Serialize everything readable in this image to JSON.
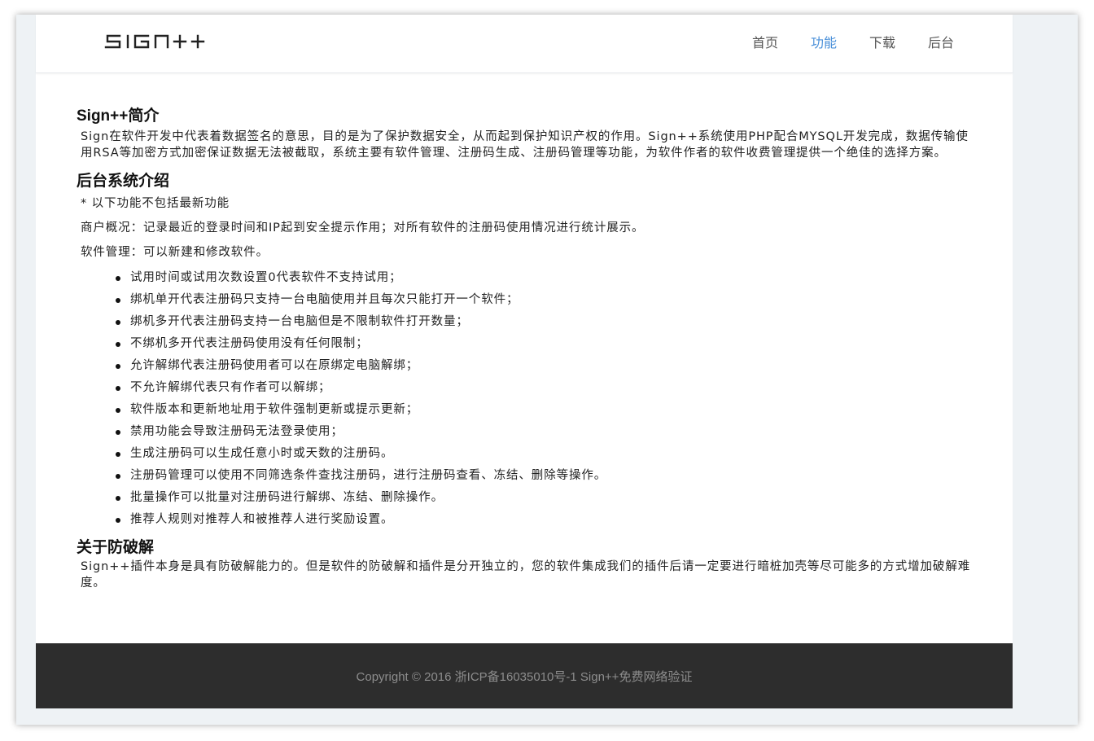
{
  "header": {
    "logo_text": "SIGN++",
    "nav": [
      {
        "label": "首页",
        "active": false
      },
      {
        "label": "功能",
        "active": true
      },
      {
        "label": "下载",
        "active": false
      },
      {
        "label": "后台",
        "active": false
      }
    ]
  },
  "content": {
    "intro_title": "Sign++简介",
    "intro_text": "Sign在软件开发中代表着数据签名的意思，目的是为了保护数据安全，从而起到保护知识产权的作用。Sign++系统使用PHP配合MYSQL开发完成，数据传输使用RSA等加密方式加密保证数据无法被截取，系统主要有软件管理、注册码生成、注册码管理等功能，为软件作者的软件收费管理提供一个绝佳的选择方案。",
    "backend_title": "后台系统介绍",
    "backend_note": "* 以下功能不包括最新功能",
    "overview_text": "商户概况：记录最近的登录时间和IP起到安全提示作用；对所有软件的注册码使用情况进行统计展示。",
    "software_text": "软件管理：可以新建和修改软件。",
    "features": [
      "试用时间或试用次数设置0代表软件不支持试用；",
      "绑机单开代表注册码只支持一台电脑使用并且每次只能打开一个软件；",
      "绑机多开代表注册码支持一台电脑但是不限制软件打开数量；",
      "不绑机多开代表注册码使用没有任何限制；",
      "允许解绑代表注册码使用者可以在原绑定电脑解绑；",
      "不允许解绑代表只有作者可以解绑；",
      "软件版本和更新地址用于软件强制更新或提示更新；",
      "禁用功能会导致注册码无法登录使用；",
      "生成注册码可以生成任意小时或天数的注册码。",
      "注册码管理可以使用不同筛选条件查找注册码，进行注册码查看、冻结、删除等操作。",
      "批量操作可以批量对注册码进行解绑、冻结、删除操作。",
      "推荐人规则对推荐人和被推荐人进行奖励设置。"
    ],
    "crack_title": "关于防破解",
    "crack_text": "Sign++插件本身是具有防破解能力的。但是软件的防破解和插件是分开独立的，您的软件集成我们的插件后请一定要进行暗桩加壳等尽可能多的方式增加破解难度。"
  },
  "footer": {
    "copyright": "Copyright © 2016 浙ICP备16035010号-1 Sign++免费网络验证"
  },
  "colors": {
    "nav_active": "#4a90d9",
    "footer_bg": "#2d2d2d",
    "outer_bg": "#eef2f5"
  }
}
